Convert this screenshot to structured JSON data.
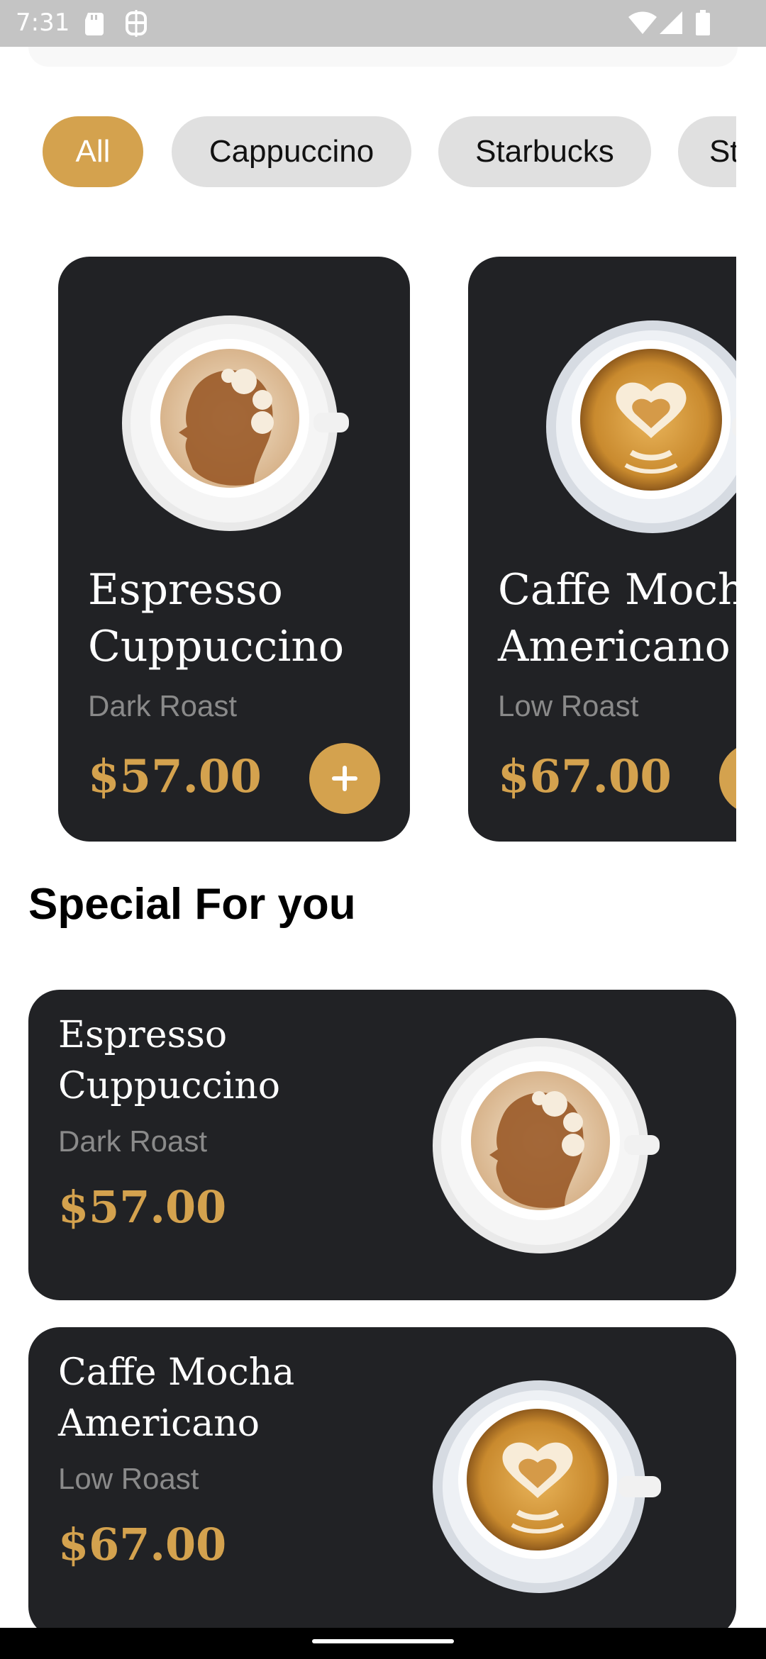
{
  "status_bar": {
    "time": "7:31",
    "icons": [
      "sd-card-icon",
      "fb-notification-icon",
      "wifi-icon",
      "signal-icon",
      "battery-icon"
    ]
  },
  "categories": {
    "chips": [
      "All",
      "Cappuccino",
      "Starbucks",
      "St"
    ],
    "selected": "All"
  },
  "products": [
    {
      "name": "Espresso\nCuppuccino",
      "roast": "Dark Roast",
      "price": "$57.00",
      "image": "head-latte-art-cup"
    },
    {
      "name": "Caffe Mocha\nAmericano",
      "roast": "Low Roast",
      "price": "$67.00",
      "image": "heart-latte-art-cup"
    }
  ],
  "special": {
    "title": "Special For you",
    "items": [
      {
        "name": "Espresso\nCuppuccino",
        "roast": "Dark Roast",
        "price": "$57.00",
        "image": "head-latte-art-cup"
      },
      {
        "name": "Caffe Mocha\nAmericano",
        "roast": "Low Roast",
        "price": "$67.00",
        "image": "heart-latte-art-cup"
      }
    ]
  },
  "colors": {
    "accent": "#d4a24e",
    "card_bg": "#212225",
    "chip_bg": "#e0e0e0",
    "subtle_text": "#8a8a8a"
  }
}
